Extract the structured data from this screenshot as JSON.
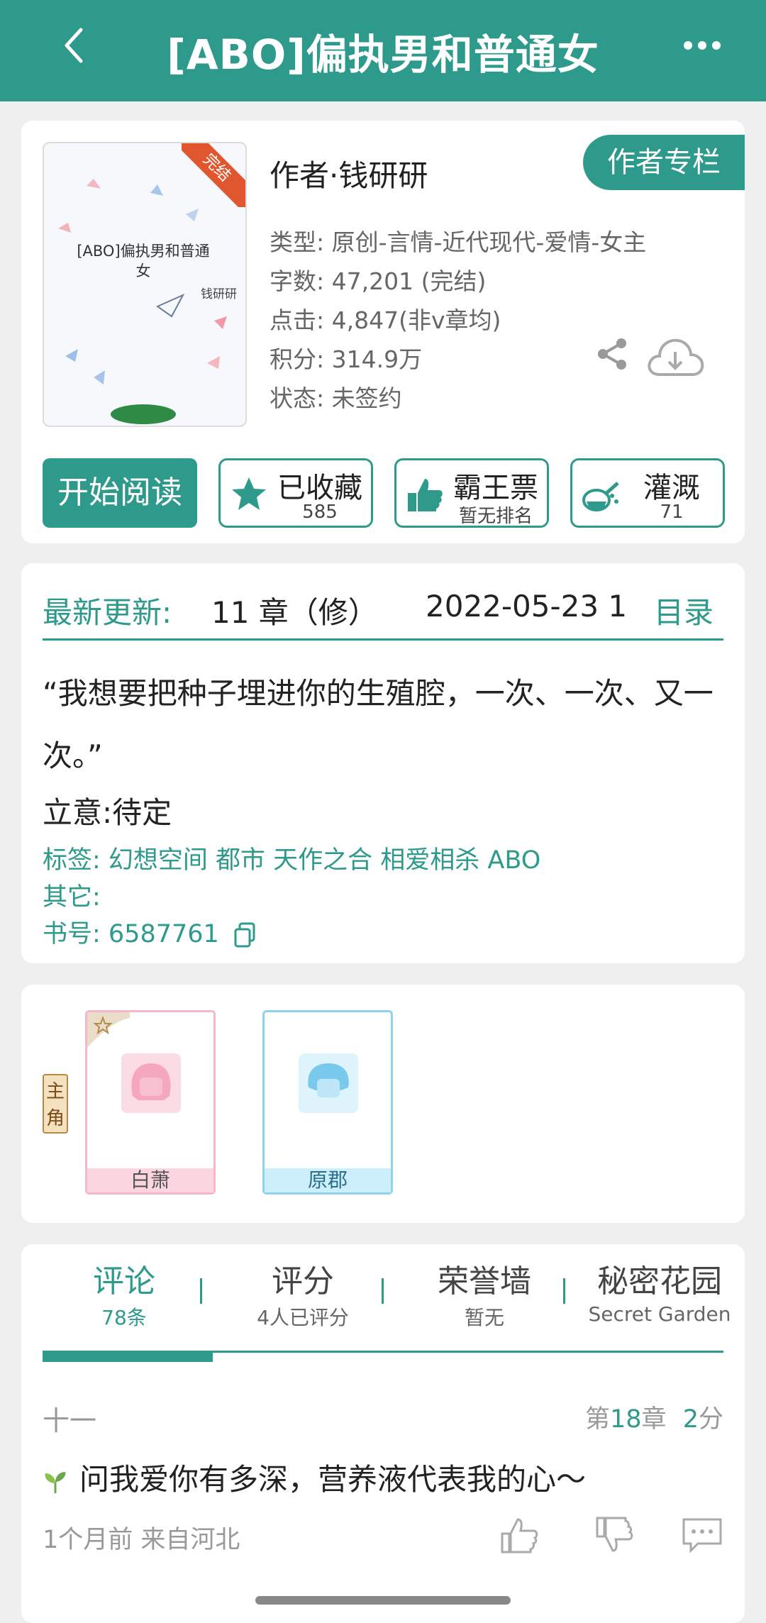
{
  "header": {
    "title": "[ABO]偏执男和普通女"
  },
  "book": {
    "cover_title": "[ABO]偏执男和普通女",
    "cover_author": "钱研研",
    "cover_badge": "完结",
    "author_line": "作者·钱研研",
    "author_column": "作者专栏",
    "meta": [
      "类型: 原创-言情-近代现代-爱情-女主",
      "字数: 47,201 (完结)",
      "点击: 4,847(非v章均)",
      "积分: 314.9万",
      "状态: 未签约"
    ],
    "start_read": "开始阅读",
    "actions": [
      {
        "label": "已收藏",
        "sub": "585",
        "icon": "star-icon"
      },
      {
        "label": "霸王票",
        "sub": "暂无排名",
        "icon": "thumbs-up-icon"
      },
      {
        "label": "灌溉",
        "sub": "71",
        "icon": "watering-can-icon"
      }
    ]
  },
  "update": {
    "label": "最新更新:",
    "chapter": "11 章（修）",
    "date": "2022-05-23 1",
    "toc": "目录"
  },
  "intro": {
    "description": "“我想要把种子埋进你的生殖腔，一次、一次、又一次。”",
    "theme": "立意:待定",
    "tags": "标签: 幻想空间 都市 天作之合 相爱相杀 ABO",
    "others": "其它:",
    "book_number": "书号: 6587761"
  },
  "characters": {
    "role_label": "主角",
    "list": [
      {
        "name": "白萧",
        "color": "#f4b8c8"
      },
      {
        "name": "原郡",
        "color": "#8fd3ef"
      }
    ]
  },
  "tabs": [
    {
      "label": "评论",
      "sub": "78条"
    },
    {
      "label": "评分",
      "sub": "4人已评分"
    },
    {
      "label": "荣誉墙",
      "sub": "暂无"
    },
    {
      "label": "秘密花园",
      "sub": "Secret Garden"
    }
  ],
  "comment": {
    "user": "十一",
    "chapter_prefix": "第",
    "chapter_num": "18",
    "chapter_suffix": "章",
    "score_num": "2",
    "score_suffix": "分",
    "text": "问我爱你有多深，营养液代表我的心～",
    "time": "1个月前  来自河北"
  },
  "colors": {
    "accent": "#2e9a8c",
    "badge": "#e0562f"
  }
}
